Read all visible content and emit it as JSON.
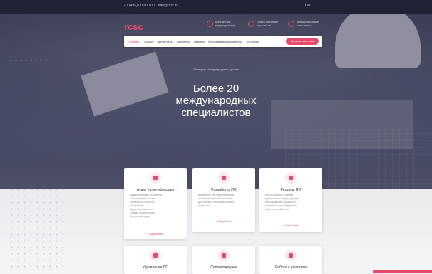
{
  "topbar": {
    "phone": "+7 (495) 000-00-00",
    "email": "info@rcsc.ru",
    "social": "f  vk"
  },
  "header": {
    "logo": "rcsc",
    "items": [
      {
        "label": "Контактные подразделения"
      },
      {
        "label": "Отдел обучения персонала"
      },
      {
        "label": "Международные отношения"
      }
    ]
  },
  "nav": {
    "items": [
      "Главная",
      "Услуги",
      "Экспертиза",
      "Партнёры",
      "Новости",
      "Нормативные документы",
      "Контакты"
    ],
    "cta": "Записаться к нам"
  },
  "hero": {
    "subtitle": "Эксперты международного уровня",
    "title_line1": "Более 20",
    "title_line2": "международных",
    "title_line3": "специалистов"
  },
  "cards": [
    {
      "title": "Аудит и сертификация",
      "lines": [
        "Международные стандарты",
        "Сертификация систем",
        "Экспертиза проектов",
        "Консалтинг",
        "Аудит безопасности",
        "Оценка соответствия",
        "Внутренний аудит"
      ],
      "more": "Подробнее"
    },
    {
      "title": "Разработка ПО",
      "lines": [
        "Внедрение систем управления",
        "и программного обеспечения",
        "для бизнеса любого масштаба",
        "и отрасли"
      ],
      "more": "Подробнее"
    },
    {
      "title": "Ресурсы ПО",
      "lines": [
        "Анализ рисков и оценка",
        "уязвимостей инфраструктуры",
        "и программных продуктов",
        "организации и предприятия",
        "с учётом требований"
      ],
      "more": "Подробнее"
    },
    {
      "title": "Управление ПО"
    },
    {
      "title": "Сопровождение"
    },
    {
      "title": "Работа с клиентом"
    }
  ]
}
